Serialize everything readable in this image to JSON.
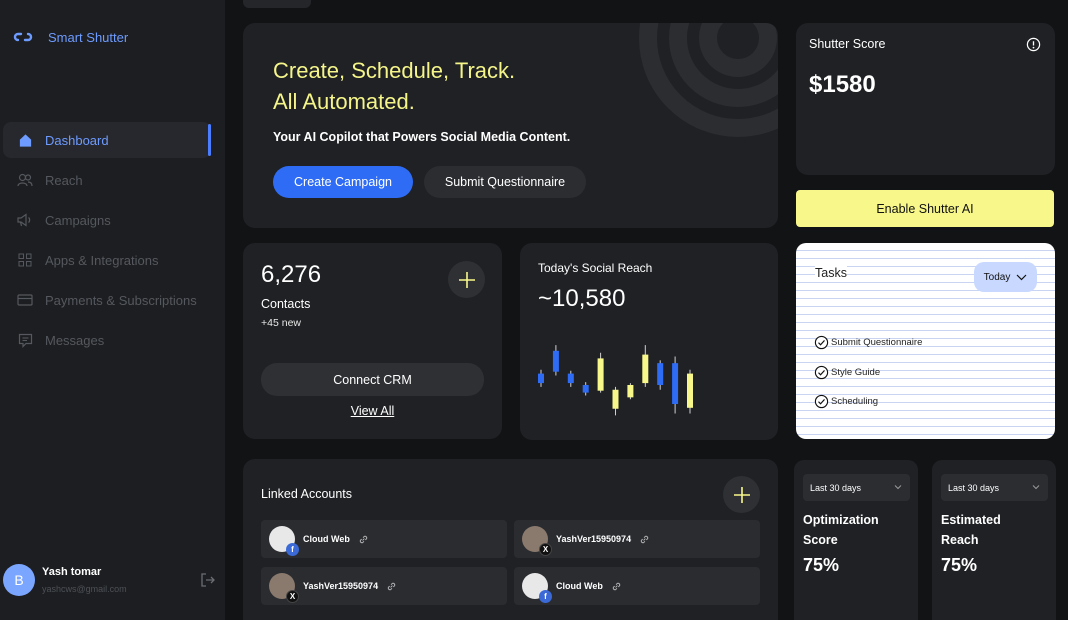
{
  "brand": {
    "name": "Smart Shutter"
  },
  "nav": {
    "items": [
      {
        "label": "Dashboard",
        "icon": "home-icon",
        "active": true
      },
      {
        "label": "Reach",
        "icon": "users-icon"
      },
      {
        "label": "Campaigns",
        "icon": "megaphone-icon"
      },
      {
        "label": "Apps & Integrations",
        "icon": "grid-icon"
      },
      {
        "label": "Payments & Subscriptions",
        "icon": "credit-card-icon"
      },
      {
        "label": "Messages",
        "icon": "message-icon"
      }
    ]
  },
  "user": {
    "initial": "B",
    "name": "Yash tomar",
    "email": "yashcws@gmail.com"
  },
  "hero": {
    "title_line1": "Create, Schedule, Track.",
    "title_line2": "All Automated.",
    "subtitle": "Your AI Copilot that Powers Social Media Content.",
    "primary_button": "Create Campaign",
    "secondary_button": "Submit Questionnaire"
  },
  "score": {
    "label": "Shutter Score",
    "value": "$1580"
  },
  "enable_button": "Enable Shutter AI",
  "contacts": {
    "value": "6,276",
    "label": "Contacts",
    "new": "+45 new",
    "connect_button": "Connect CRM",
    "view_all": "View All"
  },
  "reach": {
    "label": "Today's Social Reach",
    "value": "~10,580"
  },
  "chart_data": {
    "type": "candlestick",
    "title": "Today's Social Reach",
    "candles": [
      {
        "open": 52,
        "close": 42,
        "high": 56,
        "low": 38,
        "color": "blue"
      },
      {
        "open": 76,
        "close": 54,
        "high": 82,
        "low": 50,
        "color": "blue"
      },
      {
        "open": 52,
        "close": 42,
        "high": 55,
        "low": 38,
        "color": "blue"
      },
      {
        "open": 40,
        "close": 32,
        "high": 43,
        "low": 29,
        "color": "blue"
      },
      {
        "open": 34,
        "close": 68,
        "high": 74,
        "low": 32,
        "color": "yellow"
      },
      {
        "open": 15,
        "close": 35,
        "high": 38,
        "low": 8,
        "color": "yellow"
      },
      {
        "open": 27,
        "close": 40,
        "high": 42,
        "low": 25,
        "color": "yellow"
      },
      {
        "open": 42,
        "close": 72,
        "high": 82,
        "low": 38,
        "color": "yellow"
      },
      {
        "open": 63,
        "close": 40,
        "high": 66,
        "low": 35,
        "color": "blue"
      },
      {
        "open": 63,
        "close": 20,
        "high": 70,
        "low": 10,
        "color": "blue"
      },
      {
        "open": 16,
        "close": 52,
        "high": 56,
        "low": 10,
        "color": "yellow"
      }
    ],
    "colors": {
      "blue": "#2f6cf6",
      "yellow": "#f8f88a"
    }
  },
  "tasks": {
    "title": "Tasks",
    "filter": "Today",
    "items": [
      "Submit Questionnaire",
      "Style Guide",
      "Scheduling"
    ]
  },
  "linked": {
    "title": "Linked Accounts",
    "accounts": [
      {
        "name": "Cloud Web",
        "network": "f"
      },
      {
        "name": "YashVer15950974",
        "network": "X"
      },
      {
        "name": "YashVer15950974",
        "network": "X"
      },
      {
        "name": "Cloud Web",
        "network": "f"
      }
    ]
  },
  "metrics": [
    {
      "period": "Last 30 days",
      "label": "Optimization Score",
      "value": "75%"
    },
    {
      "period": "Last 30 days",
      "label": "Estimated Reach",
      "value": "75%"
    }
  ],
  "colors": {
    "accent": "#2f6cf6",
    "highlight": "#f8f88a",
    "nav_active": "#6e9bff"
  }
}
